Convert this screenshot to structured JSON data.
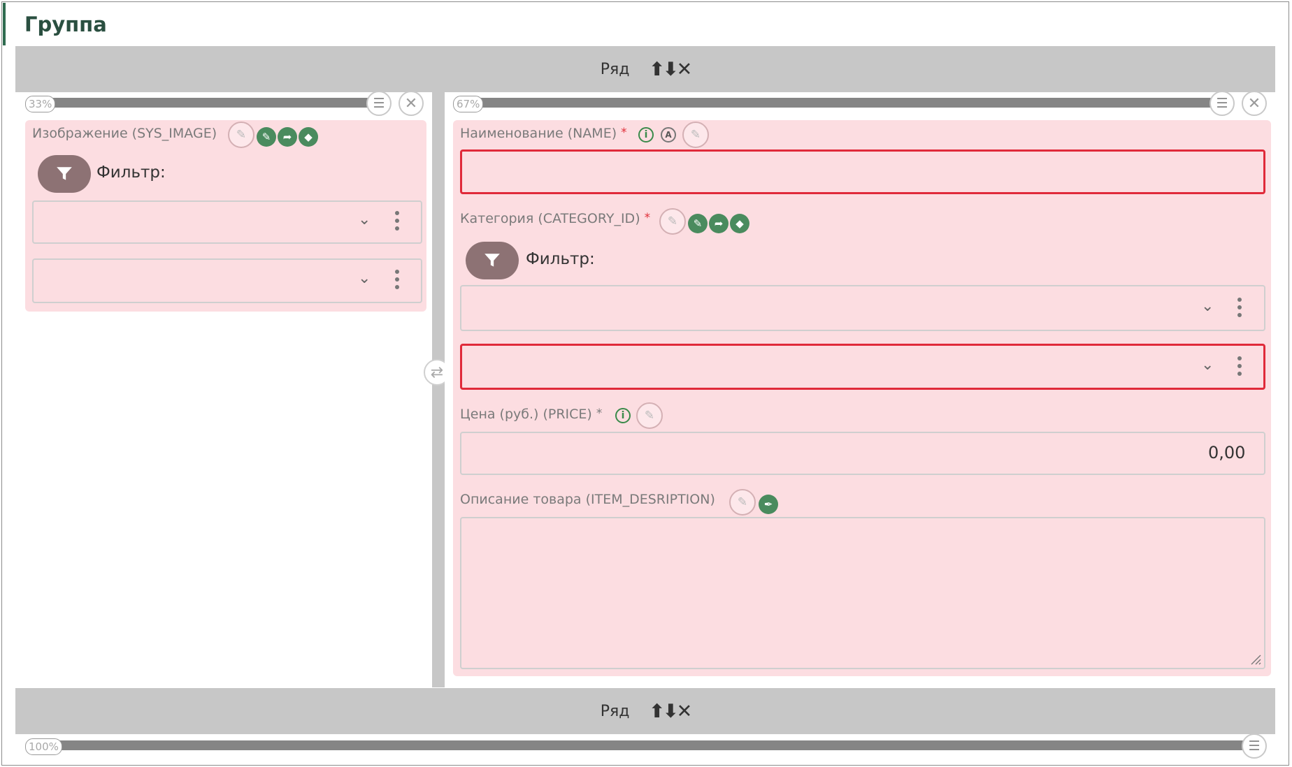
{
  "group": {
    "title": "Группа"
  },
  "rows": [
    {
      "label": "Ряд",
      "controls": "⬆⬇✕"
    },
    {
      "label": "Ряд",
      "controls": "⬆⬇✕"
    }
  ],
  "left_column": {
    "width_label": "33%",
    "field": {
      "label": "Изображение (SYS_IMAGE)",
      "filter_label": "Фильтр:"
    }
  },
  "right_column": {
    "width_label": "67%",
    "name_field": {
      "label": "Наименование (NAME)",
      "required": "*"
    },
    "category_field": {
      "label": "Категория (CATEGORY_ID)",
      "required": "*",
      "filter_label": "Фильтр:"
    },
    "price_field": {
      "label": "Цена (руб.) (PRICE)",
      "required": "*",
      "value": "0,00"
    },
    "description_field": {
      "label": "Описание товара (ITEM_DESRIPTION)"
    }
  },
  "second_row": {
    "width_label": "100%"
  },
  "icons": {
    "edit": "edit-icon",
    "pencil": "pencil-icon",
    "share": "share-arrow-icon",
    "eraser": "eraser-icon",
    "info": "info-icon",
    "auto": "auto-a-icon",
    "filter": "filter-funnel-icon",
    "chevron": "chevron-down-icon",
    "menu": "vertical-dots-icon",
    "close": "close-icon",
    "swap": "swap-arrows-icon",
    "list": "list-icon",
    "pin": "pin-icon"
  },
  "colors": {
    "accent": "#2e6b4f",
    "field_bg": "#fcdde1",
    "error_border": "#e02a3a",
    "green_action": "#4a8b5e",
    "row_bar": "#c7c7c7"
  }
}
